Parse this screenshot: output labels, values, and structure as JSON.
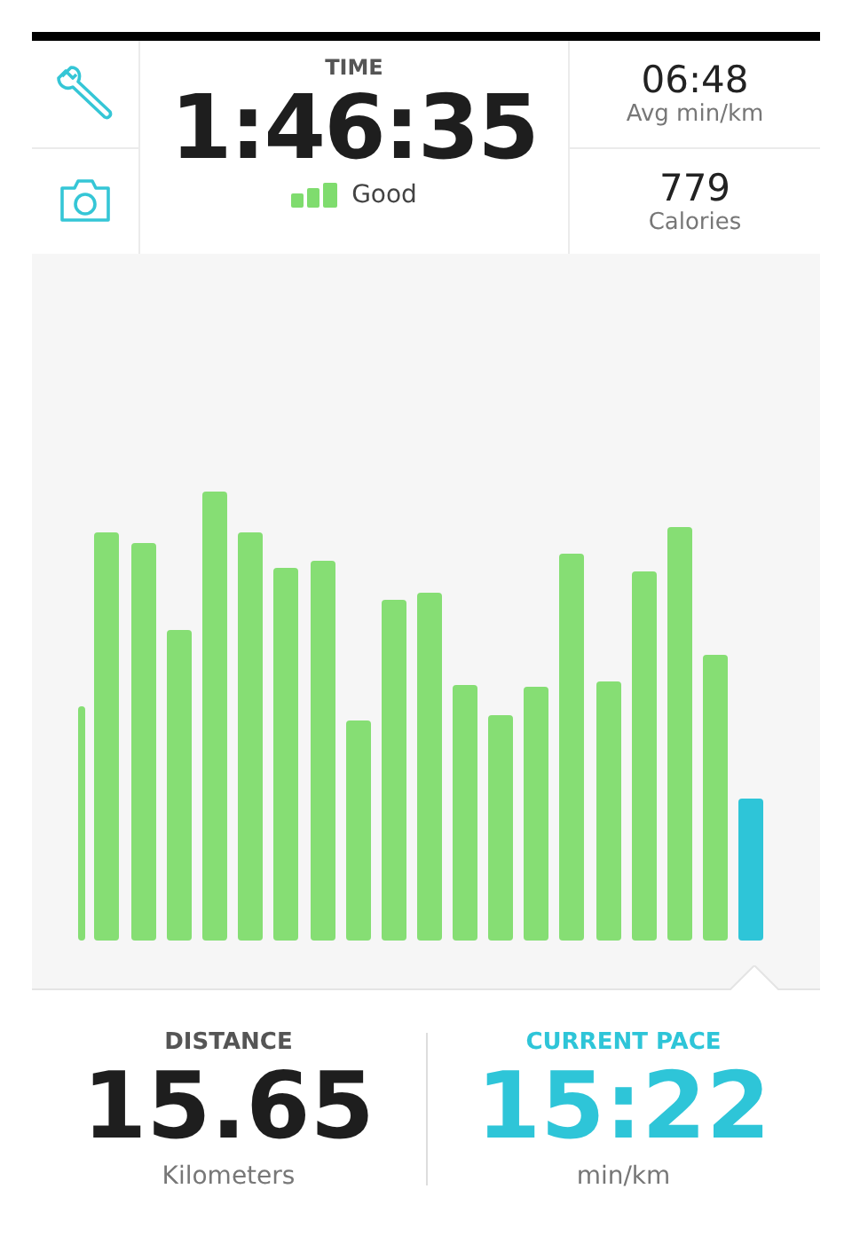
{
  "time": {
    "label": "TIME",
    "value": "1:46:35",
    "signal": {
      "label": "Good"
    }
  },
  "stats": [
    {
      "value": "06:48",
      "label": "Avg min/km"
    },
    {
      "value": "779",
      "label": "Calories"
    }
  ],
  "bottom": [
    {
      "label": "DISTANCE",
      "value": "15.65",
      "unit": "Kilometers",
      "highlight": false
    },
    {
      "label": "CURRENT PACE",
      "value": "15:22",
      "unit": "min/km",
      "highlight": true
    }
  ]
}
